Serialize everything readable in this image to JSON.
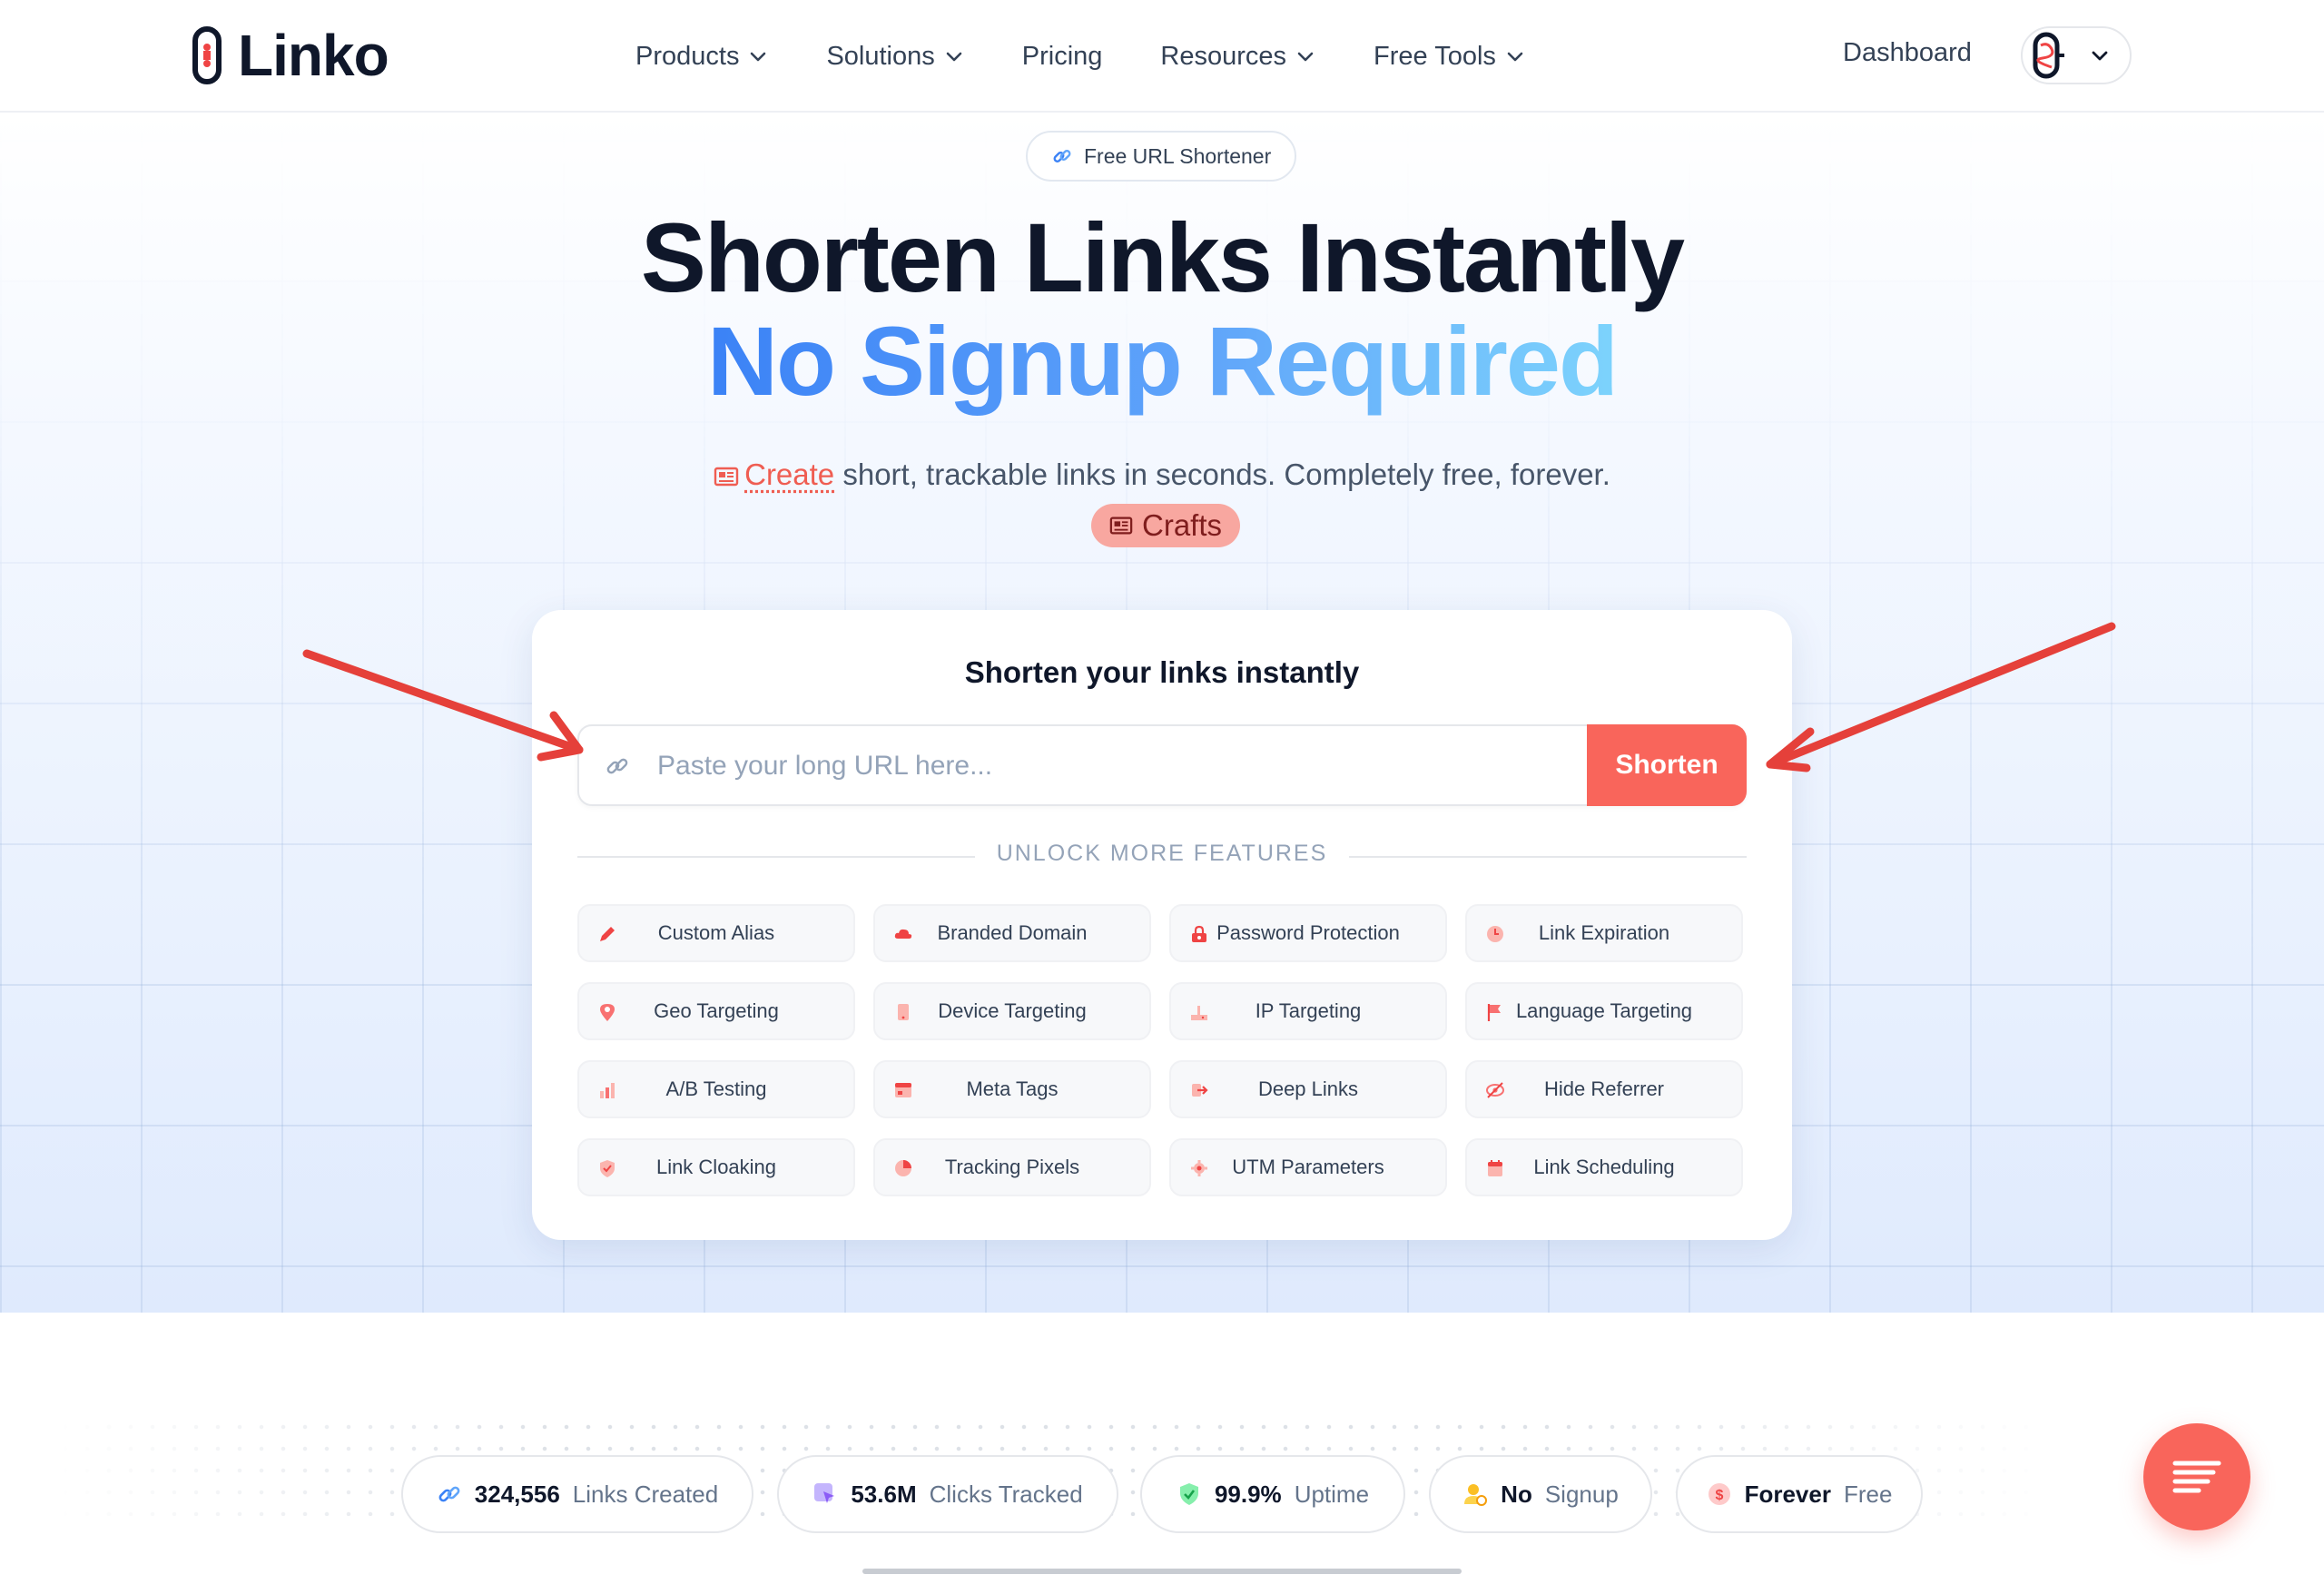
{
  "header": {
    "brand": "Linko",
    "nav": [
      {
        "label": "Products",
        "has_menu": true
      },
      {
        "label": "Solutions",
        "has_menu": true
      },
      {
        "label": "Pricing",
        "has_menu": false
      },
      {
        "label": "Resources",
        "has_menu": true
      },
      {
        "label": "Free Tools",
        "has_menu": true
      }
    ],
    "dashboard_label": "Dashboard"
  },
  "hero": {
    "badge": "Free URL Shortener",
    "title_line1": "Shorten Links Instantly",
    "title_line2": "No Signup Required",
    "subtitle_link": "Create",
    "subtitle_rest": " short, trackable links in seconds. Completely free, forever.",
    "crafts_label": "Crafts"
  },
  "card": {
    "title": "Shorten your links instantly",
    "url_placeholder": "Paste your long URL here...",
    "shorten_label": "Shorten",
    "unlock_label": "UNLOCK MORE FEATURES",
    "features": [
      {
        "label": "Custom Alias",
        "icon": "pencil-icon"
      },
      {
        "label": "Branded Domain",
        "icon": "cloud-icon"
      },
      {
        "label": "Password Protection",
        "icon": "lock-icon"
      },
      {
        "label": "Link Expiration",
        "icon": "clock-icon"
      },
      {
        "label": "Geo Targeting",
        "icon": "map-pin-icon"
      },
      {
        "label": "Device Targeting",
        "icon": "phone-icon"
      },
      {
        "label": "IP Targeting",
        "icon": "network-icon"
      },
      {
        "label": "Language Targeting",
        "icon": "flag-icon"
      },
      {
        "label": "A/B Testing",
        "icon": "bar-chart-icon"
      },
      {
        "label": "Meta Tags",
        "icon": "window-icon"
      },
      {
        "label": "Deep Links",
        "icon": "deep-link-icon"
      },
      {
        "label": "Hide Referrer",
        "icon": "eye-off-icon"
      },
      {
        "label": "Link Cloaking",
        "icon": "shield-icon"
      },
      {
        "label": "Tracking Pixels",
        "icon": "pie-icon"
      },
      {
        "label": "UTM Parameters",
        "icon": "cog-icon"
      },
      {
        "label": "Link Scheduling",
        "icon": "calendar-icon"
      }
    ]
  },
  "stats": [
    {
      "value": "324,556",
      "label": "Links Created",
      "icon": "link-icon"
    },
    {
      "value": "53.6M",
      "label": "Clicks Tracked",
      "icon": "cursor-icon"
    },
    {
      "value": "99.9%",
      "label": "Uptime",
      "icon": "shield-check-icon"
    },
    {
      "value": "No",
      "label": "Signup",
      "icon": "user-icon"
    },
    {
      "value": "Forever",
      "label": "Free",
      "icon": "dollar-icon"
    }
  ],
  "colors": {
    "accent": "#f9655b",
    "blue": "#3b82f6",
    "annotation_arrow": "#e5403a"
  }
}
